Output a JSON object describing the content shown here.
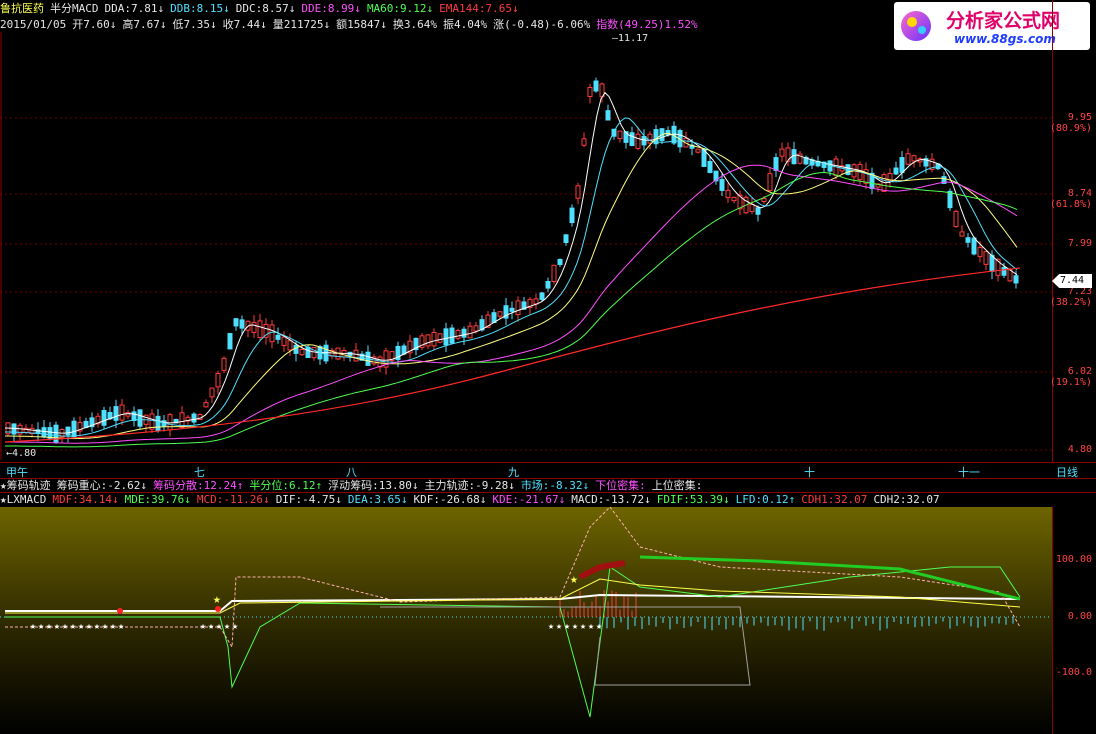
{
  "header": {
    "stock_name": "鲁抗医药",
    "indicator_name": "半分MACD",
    "items": [
      {
        "label": "DDA:7.81↓",
        "color": "#e6e6e6"
      },
      {
        "label": "DDB:8.15↓",
        "color": "#4fe0ff"
      },
      {
        "label": "DDC:8.57↓",
        "color": "#e6e6e6"
      },
      {
        "label": "DDE:8.99↓",
        "color": "#ff4fff"
      },
      {
        "label": "MA60:9.12↓",
        "color": "#4fff4f"
      },
      {
        "label": "EMA144:7.65↓",
        "color": "#ff3b3b"
      }
    ]
  },
  "quote_line": {
    "date": "2015/01/05",
    "items": [
      {
        "label": "开7.60↓",
        "color": "#e6e6e6"
      },
      {
        "label": "高7.67↓",
        "color": "#e6e6e6"
      },
      {
        "label": "低7.35↓",
        "color": "#e6e6e6"
      },
      {
        "label": "收7.44↓",
        "color": "#e6e6e6"
      },
      {
        "label": "量211725↓",
        "color": "#e6e6e6"
      },
      {
        "label": "额15847↓",
        "color": "#e6e6e6"
      },
      {
        "label": "换3.64%",
        "color": "#e6e6e6"
      },
      {
        "label": "振4.04%",
        "color": "#e6e6e6"
      },
      {
        "label": "涨(-0.48)-6.06%",
        "color": "#e6e6e6"
      },
      {
        "label": "指数(49.25)1.52%",
        "color": "#ff4fff"
      }
    ]
  },
  "price_axis": {
    "labels": [
      {
        "value": "9.95",
        "pct": "(80.9%)"
      },
      {
        "value": "8.74",
        "pct": "(61.8%)"
      },
      {
        "value": "7.99",
        "pct": ""
      },
      {
        "value": "7.23",
        "pct": "(38.2%)"
      },
      {
        "value": "6.02",
        "pct": "(19.1%)"
      },
      {
        "value": "4.80",
        "pct": ""
      }
    ],
    "current": "7.44",
    "high_marker": "11.17",
    "low_marker": "4.80"
  },
  "month_axis": {
    "labels": [
      "甲午",
      "七",
      "八",
      "九",
      "十",
      "十一"
    ],
    "period_button": "日线"
  },
  "chip_line": {
    "title": "★筹码轨迹",
    "items": [
      {
        "label": "筹码重心:-2.62↓",
        "color": "#e6e6e6"
      },
      {
        "label": "筹码分散:12.24↑",
        "color": "#ff4fff"
      },
      {
        "label": "半分位:6.12↑",
        "color": "#4fff4f"
      },
      {
        "label": "浮动筹码:13.80↓",
        "color": "#e6e6e6"
      },
      {
        "label": "主力轨迹:-9.28↓",
        "color": "#e6e6e6"
      },
      {
        "label": "市场:-8.32↓",
        "color": "#4fe0ff"
      },
      {
        "label": "下位密集:",
        "color": "#ff4fff"
      },
      {
        "label": "上位密集:",
        "color": "#e6e6e6"
      }
    ]
  },
  "macd_line": {
    "title": "★LXMACD",
    "items": [
      {
        "label": "MDF:34.14↓",
        "color": "#ff3b3b"
      },
      {
        "label": "MDE:39.76↓",
        "color": "#4fff4f"
      },
      {
        "label": "MCD:-11.26↓",
        "color": "#ff3b3b"
      },
      {
        "label": "DIF:-4.75↓",
        "color": "#e6e6e6"
      },
      {
        "label": "DEA:3.65↓",
        "color": "#4fe0ff"
      },
      {
        "label": "KDF:-26.68↓",
        "color": "#e6e6e6"
      },
      {
        "label": "KDE:-21.67↓",
        "color": "#ff4fff"
      },
      {
        "label": "MACD:-13.72↓",
        "color": "#e6e6e6"
      },
      {
        "label": "FDIF:53.39↓",
        "color": "#4fff4f"
      },
      {
        "label": "LFD:0.12↑",
        "color": "#4fe0ff"
      },
      {
        "label": "CDH1:32.07",
        "color": "#ff3b3b"
      },
      {
        "label": "CDH2:32.07",
        "color": "#e6e6e6"
      }
    ]
  },
  "sub_axis": {
    "labels": [
      "100.00",
      "0.00",
      "-100.0"
    ]
  },
  "logo": {
    "title": "分析家公式网",
    "url": "www.88gs.com"
  },
  "colors": {
    "up": "#ff3b3b",
    "down": "#4fe0ff",
    "grid": "#7a0000",
    "accent_yellow": "#ffff4f"
  }
}
